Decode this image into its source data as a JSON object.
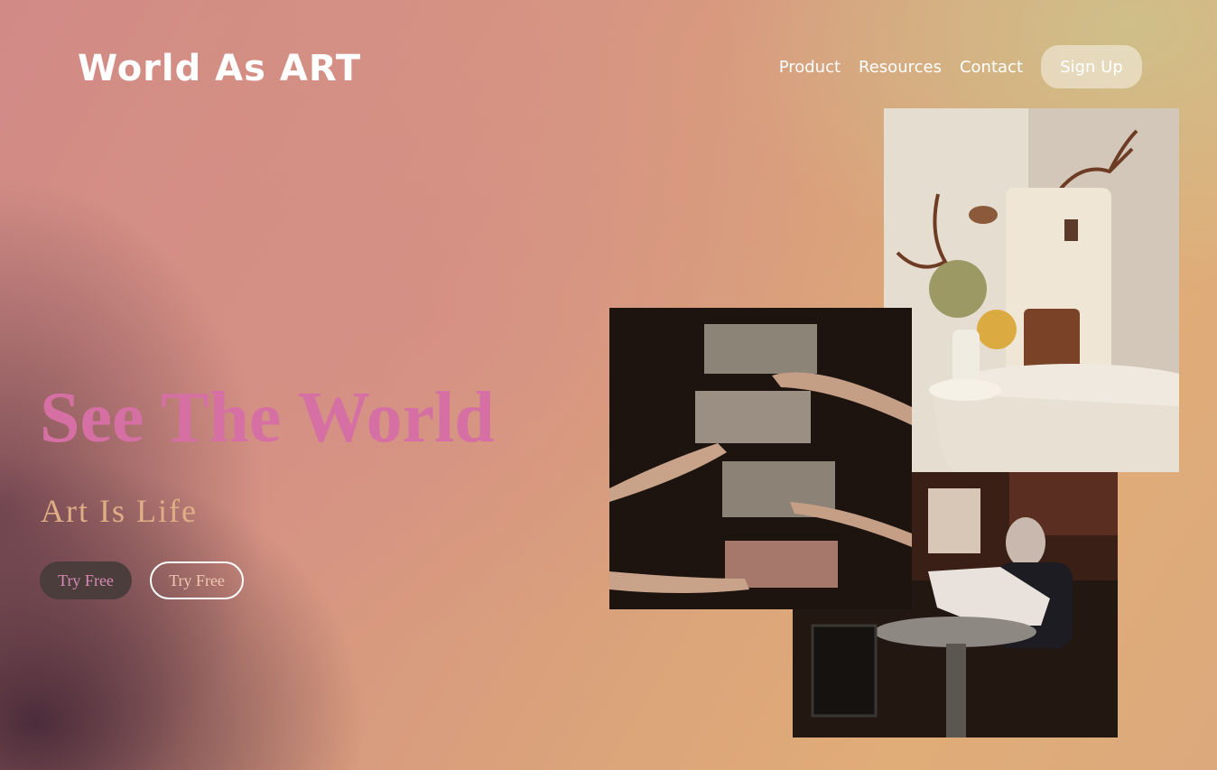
{
  "header": {
    "logo": "World As ART",
    "nav": [
      {
        "label": "Product"
      },
      {
        "label": "Resources"
      },
      {
        "label": "Contact"
      }
    ],
    "signup_label": "Sign Up"
  },
  "hero": {
    "headline": "See The World",
    "subheadline": "Art Is Life",
    "primary_cta": "Try Free",
    "secondary_cta": "Try Free"
  },
  "colors": {
    "headline": "#d66fa3",
    "subheadline": "#e0ae86",
    "primary_button_bg": "#4b3d3b"
  },
  "images": [
    {
      "name": "room-still-life-photo"
    },
    {
      "name": "woman-reading-newspaper-photo"
    },
    {
      "name": "hands-holding-art-prints-photo"
    }
  ]
}
